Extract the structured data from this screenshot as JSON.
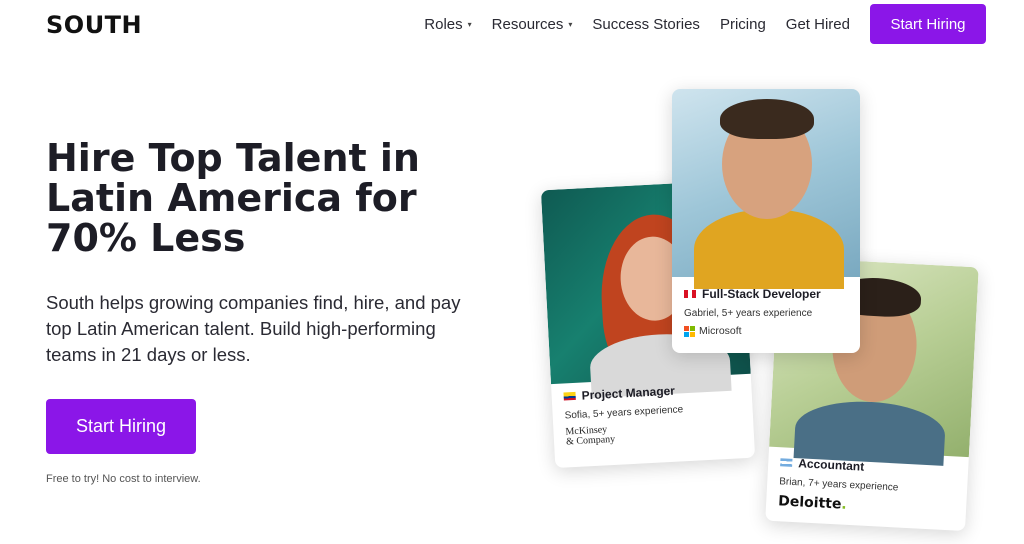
{
  "brand": {
    "logo": "SOUTH"
  },
  "nav": {
    "items": [
      {
        "label": "Roles",
        "has_dropdown": true
      },
      {
        "label": "Resources",
        "has_dropdown": true
      },
      {
        "label": "Success Stories",
        "has_dropdown": false
      },
      {
        "label": "Pricing",
        "has_dropdown": false
      },
      {
        "label": "Get Hired",
        "has_dropdown": false
      }
    ],
    "cta": "Start Hiring",
    "caret_glyph": "▾"
  },
  "hero": {
    "headline_lines": [
      "Hire Top Talent in",
      "Latin America for",
      "70% Less"
    ],
    "subtext_lines": [
      "South helps growing companies find, hire, and pay",
      "top Latin American talent. Build high-performing",
      "teams in 21 days or less."
    ],
    "cta": "Start Hiring",
    "note": "Free to try! No cost to interview."
  },
  "cards": {
    "project_manager": {
      "role": "Project Manager",
      "experience": "Sofia, 5+ years experience",
      "company_line1": "McKinsey",
      "company_line2": "& Company",
      "flag": "flag-icon-colombia"
    },
    "fullstack": {
      "role": "Full-Stack Developer",
      "experience": "Gabriel, 5+ years experience",
      "company": "Microsoft",
      "flag": "flag-icon-peru"
    },
    "accountant": {
      "role": "Accountant",
      "experience": "Brian, 7+ years experience",
      "company": "Deloitte",
      "company_dot": ".",
      "flag": "flag-icon-argentina"
    }
  },
  "colors": {
    "accent": "#8b16e8",
    "text": "#1d1d26",
    "deloitte_green": "#86bc25"
  }
}
